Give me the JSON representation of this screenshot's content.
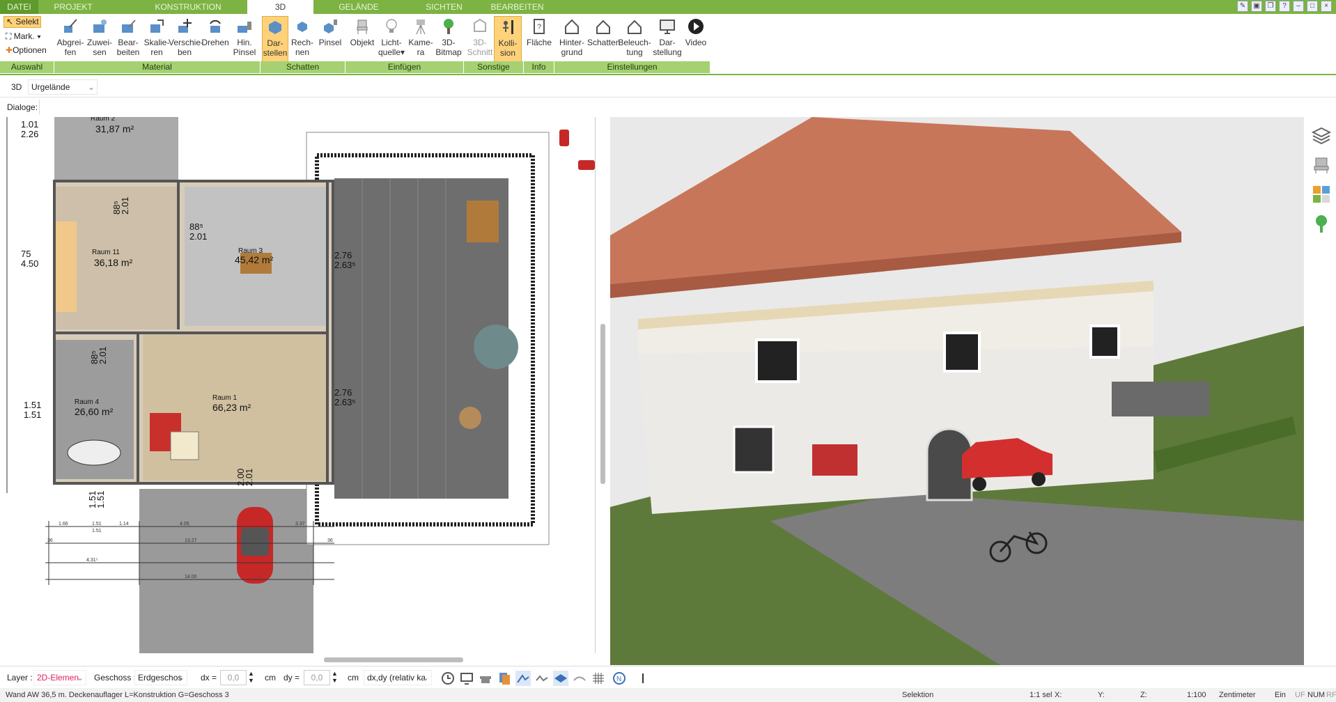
{
  "tabs": [
    {
      "label": "DATEI"
    },
    {
      "label": "PROJEKT"
    },
    {
      "label": "KONSTRUKTION"
    },
    {
      "label": "3D"
    },
    {
      "label": "GELÄNDE"
    },
    {
      "label": "SICHTEN"
    },
    {
      "label": "BEARBEITEN"
    }
  ],
  "ribbon": {
    "selekt": "Selekt",
    "mark": "Mark.",
    "optionen": "Optionen",
    "buttons": [
      {
        "label1": "Abgrei-",
        "label2": "fen"
      },
      {
        "label1": "Zuwei-",
        "label2": "sen"
      },
      {
        "label1": "Bear-",
        "label2": "beiten"
      },
      {
        "label1": "Skalie-",
        "label2": "ren"
      },
      {
        "label1": "Verschie-",
        "label2": "ben"
      },
      {
        "label1": "Drehen",
        "label2": ""
      },
      {
        "label1": "Hin.",
        "label2": "Pinsel"
      },
      {
        "label1": "Dar-",
        "label2": "stellen"
      },
      {
        "label1": "Rech-",
        "label2": "nen"
      },
      {
        "label1": "Pinsel",
        "label2": ""
      },
      {
        "label1": "Objekt",
        "label2": ""
      },
      {
        "label1": "Licht-",
        "label2": "quelle"
      },
      {
        "label1": "Kame-",
        "label2": "ra"
      },
      {
        "label1": "3D-",
        "label2": "Bitmap"
      },
      {
        "label1": "3D-",
        "label2": "Schnitt"
      },
      {
        "label1": "Kolli-",
        "label2": "sion"
      },
      {
        "label1": "Fläche",
        "label2": ""
      },
      {
        "label1": "Hinter-",
        "label2": "grund"
      },
      {
        "label1": "Schatten",
        "label2": ""
      },
      {
        "label1": "Beleuch-",
        "label2": "tung"
      },
      {
        "label1": "Dar-",
        "label2": "stellung"
      },
      {
        "label1": "Video",
        "label2": ""
      }
    ],
    "groups": [
      "Auswahl",
      "Material",
      "Schatten",
      "Einfügen",
      "Sonstige",
      "Info",
      "Einstellungen"
    ]
  },
  "views": {
    "mode": "3D",
    "combo": "Urgelände"
  },
  "dialoge": "Dialoge:",
  "plan": {
    "rooms": [
      {
        "name": "Raum 2",
        "area": "31,87 m²"
      },
      {
        "name": "Raum 11",
        "area": "36,18 m²"
      },
      {
        "name": "Raum 3",
        "area": "45,42 m²"
      },
      {
        "name": "Raum 4",
        "area": "26,60 m²"
      },
      {
        "name": "Raum 1",
        "area": "66,23 m²"
      }
    ],
    "dims": {
      "d1": "1.01",
      "d2": "2.26",
      "d3": "75",
      "d4": "4.50",
      "d5": "1.51",
      "d6": "1.51",
      "d7": "88⁵",
      "d8": "2.01",
      "d9": "88⁵",
      "d10": "2.01",
      "d11": "88⁵",
      "d12": "2.01",
      "d13": "2.76",
      "d14": "2.63⁵",
      "d15": "2.76",
      "d16": "2.63⁵",
      "d17": "2.00",
      "d18": "2.01",
      "d19": "1.51",
      "d20": "1.51",
      "d21": "1.66",
      "d22": "1.51",
      "d23": "1.14",
      "d24": "4.05",
      "d25": "3.37",
      "d26": "13.27",
      "d27": "4.31⁵",
      "d28": "14.00",
      "d29": "1.51",
      "d30": "36",
      "d31": "36"
    }
  },
  "bottom": {
    "layer_label": "Layer :",
    "layer_value": "2D-Elemen",
    "geschoss_label": "Geschoss :",
    "geschoss_value": "Erdgeschos",
    "dx_label": "dx =",
    "dx_value": "0,0",
    "dx_unit": "cm",
    "dy_label": "dy =",
    "dy_value": "0,0",
    "dy_unit": "cm",
    "mode_value": "dx,dy (relativ ka"
  },
  "status": {
    "text": "Wand AW 36,5 m. Deckenauflager L=Konstruktion G=Geschoss 3",
    "selektion": "Selektion",
    "sel": "1:1 sel",
    "x": "X:",
    "y": "Y:",
    "z": "Z:",
    "scale": "1:100",
    "unit": "Zentimeter",
    "ein": "Ein",
    "uf": "UF",
    "num": "NUM",
    "rf": "RF"
  },
  "colors": {
    "accent": "#7cb342",
    "groupbar": "#a5d173",
    "active": "#ffd27a",
    "roof": "#c8765a",
    "grass": "#5e7a3a",
    "car": "#d32f2f"
  }
}
